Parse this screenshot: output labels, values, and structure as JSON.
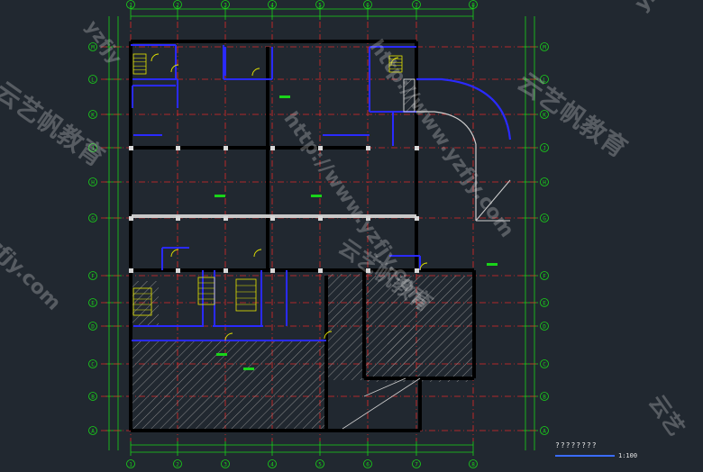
{
  "drawing": {
    "title": "????????",
    "scale": "1:100"
  },
  "watermarks": {
    "url_a": "http://www.yzfjy.com",
    "url_b": "http://www.yzfjy.com",
    "url_c": "yzfjy.com",
    "url_d": "yzfjy",
    "brand": "云艺帆教育",
    "brand_b": "云艺帆教育",
    "brand_c": "云艺帆教育",
    "fragment_a": "yzfjy",
    "fragment_b": "云艺"
  },
  "grid": {
    "top_axis": [
      "1",
      "2",
      "3",
      "4",
      "5",
      "6",
      "7",
      "8"
    ],
    "bottom_axis": [
      "1",
      "2",
      "3",
      "4",
      "5",
      "6",
      "7",
      "8"
    ],
    "left_axis": [
      "M",
      "L",
      "K",
      "J",
      "H",
      "G",
      "F",
      "E",
      "D",
      "C",
      "B",
      "A"
    ],
    "right_axis": [
      "M",
      "L",
      "K",
      "J",
      "H",
      "G",
      "F",
      "E",
      "D",
      "C",
      "B",
      "A"
    ]
  },
  "colors": {
    "background": "#212830",
    "dimension": "#19d419",
    "axis_line": "#e02828",
    "wall": "#000000",
    "partition": "#2a2aff",
    "annotation": "#e8e800",
    "hatch": "#9a9a9a",
    "text": "#e8e8e8"
  }
}
